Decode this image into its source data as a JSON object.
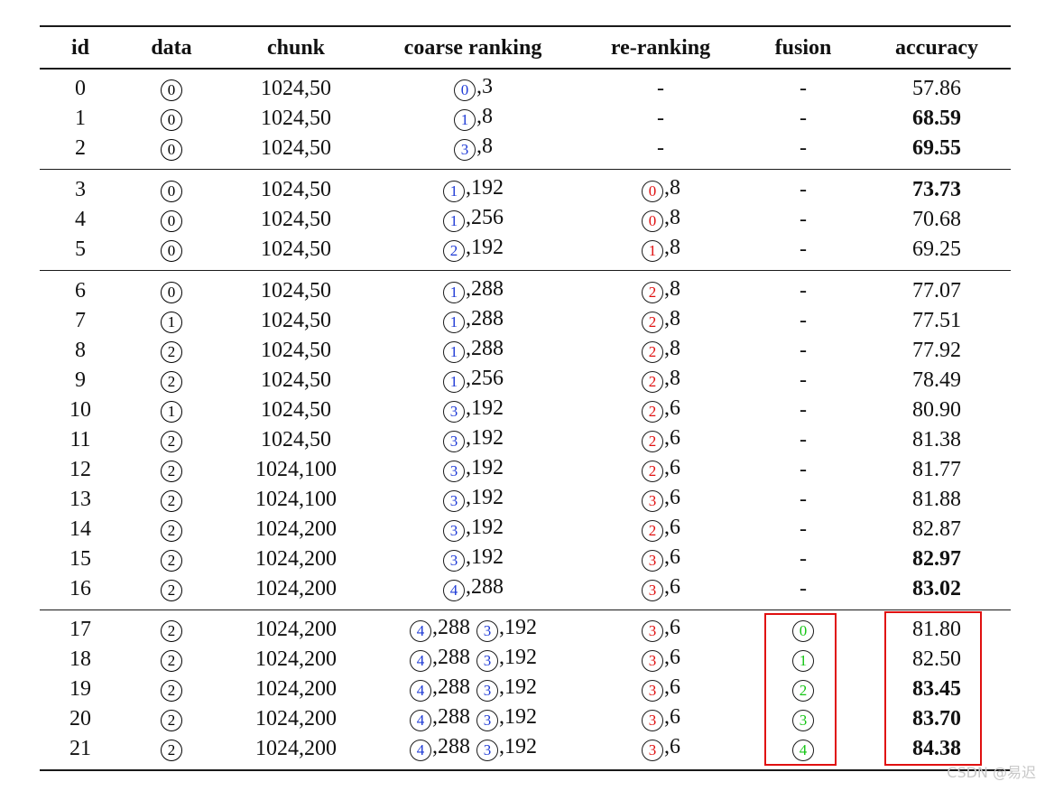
{
  "table": {
    "headers": [
      "id",
      "data",
      "chunk",
      "coarse ranking",
      "re-ranking",
      "fusion",
      "accuracy"
    ],
    "rows": [
      {
        "id": "0",
        "data": "0",
        "chunk": "1024,50",
        "coarse": [
          {
            "n": "0",
            "v": "3"
          }
        ],
        "rerank": null,
        "fusion": null,
        "accuracy": "57.86",
        "bold": false
      },
      {
        "id": "1",
        "data": "0",
        "chunk": "1024,50",
        "coarse": [
          {
            "n": "1",
            "v": "8"
          }
        ],
        "rerank": null,
        "fusion": null,
        "accuracy": "68.59",
        "bold": true
      },
      {
        "id": "2",
        "data": "0",
        "chunk": "1024,50",
        "coarse": [
          {
            "n": "3",
            "v": "8"
          }
        ],
        "rerank": null,
        "fusion": null,
        "accuracy": "69.55",
        "bold": true
      },
      {
        "id": "3",
        "data": "0",
        "chunk": "1024,50",
        "coarse": [
          {
            "n": "1",
            "v": "192"
          }
        ],
        "rerank": {
          "n": "0",
          "v": "8"
        },
        "fusion": null,
        "accuracy": "73.73",
        "bold": true
      },
      {
        "id": "4",
        "data": "0",
        "chunk": "1024,50",
        "coarse": [
          {
            "n": "1",
            "v": "256"
          }
        ],
        "rerank": {
          "n": "0",
          "v": "8"
        },
        "fusion": null,
        "accuracy": "70.68",
        "bold": false
      },
      {
        "id": "5",
        "data": "0",
        "chunk": "1024,50",
        "coarse": [
          {
            "n": "2",
            "v": "192"
          }
        ],
        "rerank": {
          "n": "1",
          "v": "8"
        },
        "fusion": null,
        "accuracy": "69.25",
        "bold": false
      },
      {
        "id": "6",
        "data": "0",
        "chunk": "1024,50",
        "coarse": [
          {
            "n": "1",
            "v": "288"
          }
        ],
        "rerank": {
          "n": "2",
          "v": "8"
        },
        "fusion": null,
        "accuracy": "77.07",
        "bold": false
      },
      {
        "id": "7",
        "data": "1",
        "chunk": "1024,50",
        "coarse": [
          {
            "n": "1",
            "v": "288"
          }
        ],
        "rerank": {
          "n": "2",
          "v": "8"
        },
        "fusion": null,
        "accuracy": "77.51",
        "bold": false
      },
      {
        "id": "8",
        "data": "2",
        "chunk": "1024,50",
        "coarse": [
          {
            "n": "1",
            "v": "288"
          }
        ],
        "rerank": {
          "n": "2",
          "v": "8"
        },
        "fusion": null,
        "accuracy": "77.92",
        "bold": false
      },
      {
        "id": "9",
        "data": "2",
        "chunk": "1024,50",
        "coarse": [
          {
            "n": "1",
            "v": "256"
          }
        ],
        "rerank": {
          "n": "2",
          "v": "8"
        },
        "fusion": null,
        "accuracy": "78.49",
        "bold": false
      },
      {
        "id": "10",
        "data": "1",
        "chunk": "1024,50",
        "coarse": [
          {
            "n": "3",
            "v": "192"
          }
        ],
        "rerank": {
          "n": "2",
          "v": "6"
        },
        "fusion": null,
        "accuracy": "80.90",
        "bold": false
      },
      {
        "id": "11",
        "data": "2",
        "chunk": "1024,50",
        "coarse": [
          {
            "n": "3",
            "v": "192"
          }
        ],
        "rerank": {
          "n": "2",
          "v": "6"
        },
        "fusion": null,
        "accuracy": "81.38",
        "bold": false
      },
      {
        "id": "12",
        "data": "2",
        "chunk": "1024,100",
        "coarse": [
          {
            "n": "3",
            "v": "192"
          }
        ],
        "rerank": {
          "n": "2",
          "v": "6"
        },
        "fusion": null,
        "accuracy": "81.77",
        "bold": false
      },
      {
        "id": "13",
        "data": "2",
        "chunk": "1024,100",
        "coarse": [
          {
            "n": "3",
            "v": "192"
          }
        ],
        "rerank": {
          "n": "3",
          "v": "6"
        },
        "fusion": null,
        "accuracy": "81.88",
        "bold": false
      },
      {
        "id": "14",
        "data": "2",
        "chunk": "1024,200",
        "coarse": [
          {
            "n": "3",
            "v": "192"
          }
        ],
        "rerank": {
          "n": "2",
          "v": "6"
        },
        "fusion": null,
        "accuracy": "82.87",
        "bold": false
      },
      {
        "id": "15",
        "data": "2",
        "chunk": "1024,200",
        "coarse": [
          {
            "n": "3",
            "v": "192"
          }
        ],
        "rerank": {
          "n": "3",
          "v": "6"
        },
        "fusion": null,
        "accuracy": "82.97",
        "bold": true
      },
      {
        "id": "16",
        "data": "2",
        "chunk": "1024,200",
        "coarse": [
          {
            "n": "4",
            "v": "288"
          }
        ],
        "rerank": {
          "n": "3",
          "v": "6"
        },
        "fusion": null,
        "accuracy": "83.02",
        "bold": true
      },
      {
        "id": "17",
        "data": "2",
        "chunk": "1024,200",
        "coarse": [
          {
            "n": "4",
            "v": "288"
          },
          {
            "n": "3",
            "v": "192"
          }
        ],
        "rerank": {
          "n": "3",
          "v": "6"
        },
        "fusion": "0",
        "accuracy": "81.80",
        "bold": false
      },
      {
        "id": "18",
        "data": "2",
        "chunk": "1024,200",
        "coarse": [
          {
            "n": "4",
            "v": "288"
          },
          {
            "n": "3",
            "v": "192"
          }
        ],
        "rerank": {
          "n": "3",
          "v": "6"
        },
        "fusion": "1",
        "accuracy": "82.50",
        "bold": false
      },
      {
        "id": "19",
        "data": "2",
        "chunk": "1024,200",
        "coarse": [
          {
            "n": "4",
            "v": "288"
          },
          {
            "n": "3",
            "v": "192"
          }
        ],
        "rerank": {
          "n": "3",
          "v": "6"
        },
        "fusion": "2",
        "accuracy": "83.45",
        "bold": true
      },
      {
        "id": "20",
        "data": "2",
        "chunk": "1024,200",
        "coarse": [
          {
            "n": "4",
            "v": "288"
          },
          {
            "n": "3",
            "v": "192"
          }
        ],
        "rerank": {
          "n": "3",
          "v": "6"
        },
        "fusion": "3",
        "accuracy": "83.70",
        "bold": true
      },
      {
        "id": "21",
        "data": "2",
        "chunk": "1024,200",
        "coarse": [
          {
            "n": "4",
            "v": "288"
          },
          {
            "n": "3",
            "v": "192"
          }
        ],
        "rerank": {
          "n": "3",
          "v": "6"
        },
        "fusion": "4",
        "accuracy": "84.38",
        "bold": true
      }
    ],
    "empty_mark": "-"
  },
  "colors": {
    "data_circle": "#000000",
    "coarse_circle": "#1f3bd6",
    "rerank_circle": "#e01010",
    "fusion_circle": "#15c515",
    "highlight_box": "#e01010"
  },
  "watermark": "CSDN @易迟"
}
